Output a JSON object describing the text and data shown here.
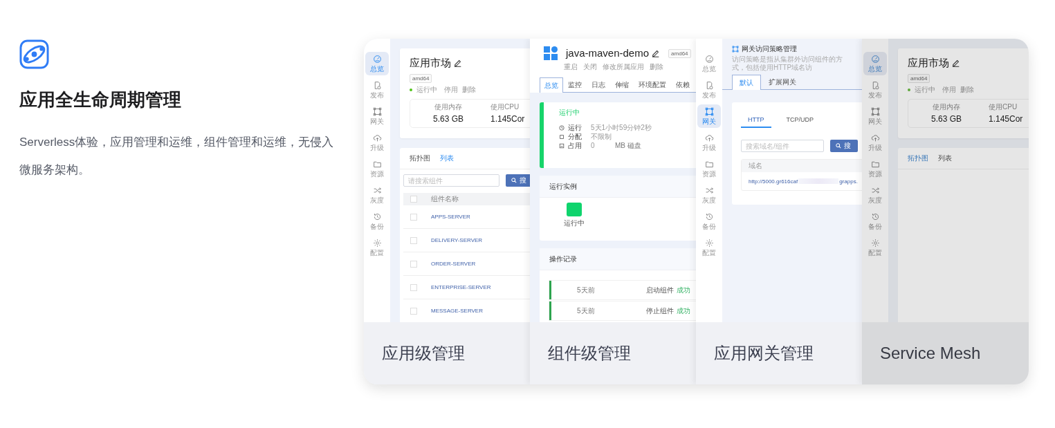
{
  "intro": {
    "title": "应用全生命周期管理",
    "description": "Serverless体验，应用管理和运维，组件管理和运维，无侵入微服务架构。"
  },
  "panels": [
    {
      "kind": "app",
      "caption": "应用级管理",
      "dimmed": false,
      "sidebar": [
        {
          "label": "总览",
          "selected": true
        },
        {
          "label": "发布",
          "selected": false
        },
        {
          "label": "网关",
          "selected": false
        },
        {
          "label": "升级",
          "selected": false
        },
        {
          "label": "资源",
          "selected": false
        },
        {
          "label": "灰度",
          "selected": false
        },
        {
          "label": "备份",
          "selected": false
        },
        {
          "label": "配置",
          "selected": false
        }
      ],
      "app": {
        "name": "应用市场",
        "arch": "amd64",
        "status": "运行中",
        "actions": [
          "停用",
          "删除"
        ],
        "stats": [
          {
            "label": "使用内存",
            "value": "5.63 GB"
          },
          {
            "label": "使用CPU",
            "value": "1.145Cor"
          }
        ],
        "tabs": [
          {
            "label": "拓扑图",
            "selected": false
          },
          {
            "label": "列表",
            "selected": true
          }
        ],
        "search": {
          "placeholder": "请搜索组件",
          "button": "搜"
        },
        "column": "组件名称",
        "all_checked": false,
        "rows": [
          {
            "name": "APPS-SERVER",
            "checked": false
          },
          {
            "name": "DELIVERY-SERVER",
            "checked": false
          },
          {
            "name": "ORDER-SERVER",
            "checked": false
          },
          {
            "name": "ENTERPRISE-SERVER",
            "checked": false
          },
          {
            "name": "MESSAGE-SERVER",
            "checked": false
          }
        ]
      }
    },
    {
      "kind": "component",
      "caption": "组件级管理",
      "dimmed": false,
      "component": {
        "name": "java-maven-demo",
        "arch": "amd64",
        "actions": [
          "重启",
          "关闭",
          "修改所属应用",
          "删除"
        ],
        "tabs": [
          {
            "label": "总览",
            "selected": true
          },
          {
            "label": "监控",
            "selected": false
          },
          {
            "label": "日志",
            "selected": false
          },
          {
            "label": "伸缩",
            "selected": false
          },
          {
            "label": "环境配置",
            "selected": false
          },
          {
            "label": "依赖",
            "selected": false
          }
        ],
        "status": "运行中",
        "details": [
          {
            "label": "运行",
            "value": "5天1小时59分钟2秒"
          },
          {
            "label": "分配",
            "value": "不限制"
          },
          {
            "label": "占用",
            "value": "0",
            "unit": "MB 磁盘"
          }
        ],
        "instances_title": "运行实例",
        "instances": [
          "运行中"
        ],
        "log_title": "操作记录",
        "log": [
          {
            "time": "5天前",
            "action": "启动组件",
            "result": "成功"
          },
          {
            "time": "5天前",
            "action": "停止组件",
            "result": "成功"
          }
        ]
      }
    },
    {
      "kind": "gateway",
      "caption": "应用网关管理",
      "dimmed": false,
      "sidebar": [
        {
          "label": "总览",
          "selected": false
        },
        {
          "label": "发布",
          "selected": false
        },
        {
          "label": "网关",
          "selected": true
        },
        {
          "label": "升级",
          "selected": false
        },
        {
          "label": "资源",
          "selected": false
        },
        {
          "label": "灰度",
          "selected": false
        },
        {
          "label": "备份",
          "selected": false
        },
        {
          "label": "配置",
          "selected": false
        }
      ],
      "gateway": {
        "title": "网关访问策略管理",
        "description": "访问策略是指从集群外访问组件的方式，包括使用HTTP域名访",
        "tabs": [
          {
            "label": "默认",
            "selected": true
          },
          {
            "label": "扩展网关",
            "selected": false
          }
        ],
        "protocols": [
          {
            "label": "HTTP",
            "selected": true
          },
          {
            "label": "TCP/UDP",
            "selected": false
          }
        ],
        "search": {
          "placeholder": "搜索域名/组件",
          "button": "搜"
        },
        "column": "域名",
        "url_parts": [
          "http://5000.gr616caf",
          "grapps."
        ]
      }
    },
    {
      "kind": "app",
      "caption": "Service Mesh",
      "dimmed": true,
      "sidebar": [
        {
          "label": "总览",
          "selected": true
        },
        {
          "label": "发布",
          "selected": false
        },
        {
          "label": "网关",
          "selected": false
        },
        {
          "label": "升级",
          "selected": false
        },
        {
          "label": "资源",
          "selected": false
        },
        {
          "label": "灰度",
          "selected": false
        },
        {
          "label": "备份",
          "selected": false
        },
        {
          "label": "配置",
          "selected": false
        }
      ],
      "app": {
        "name": "应用市场",
        "arch": "amd64",
        "status": "运行中",
        "actions": [
          "停用",
          "删除"
        ],
        "stats": [
          {
            "label": "使用内存",
            "value": "5.63 GB"
          },
          {
            "label": "使用CPU",
            "value": "1.145Cor"
          }
        ],
        "tabs": [
          {
            "label": "拓扑图",
            "selected": true
          },
          {
            "label": "列表",
            "selected": false
          }
        ]
      }
    }
  ]
}
